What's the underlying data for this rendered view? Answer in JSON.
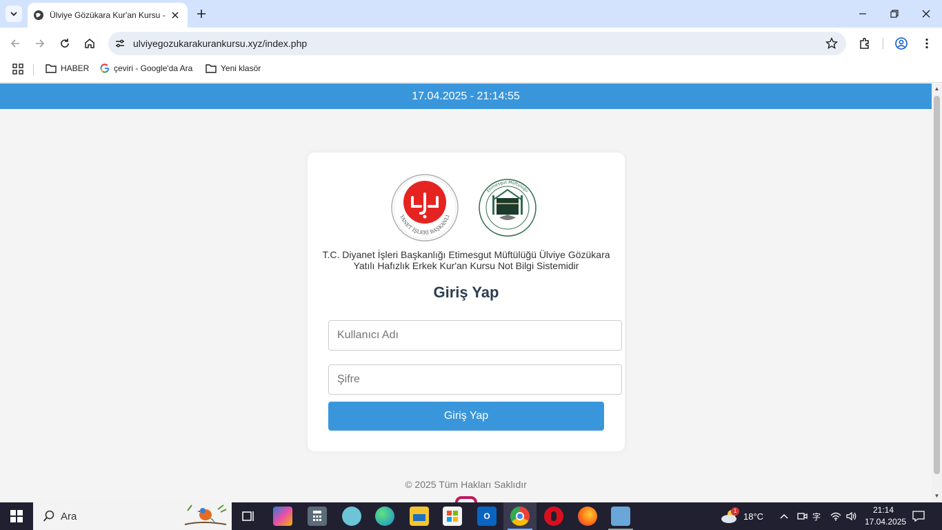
{
  "browser": {
    "tab_title": "Ülviye Gözükara Kur'an Kursu -",
    "url": "ulviyegozukarakurankursu.xyz/index.php",
    "bookmarks": [
      {
        "label": "HABER",
        "icon": "folder-icon"
      },
      {
        "label": "çeviri - Google'da Ara",
        "icon": "google-icon"
      },
      {
        "label": "Yeni klasör",
        "icon": "folder-icon"
      }
    ]
  },
  "page": {
    "datetime": "17.04.2025 - 21:14:55",
    "logos": {
      "diyanet_text": "DİYANET İŞLERİ BAŞKANLIĞI",
      "diyanet_mark": "دٮ",
      "mufti_seal": "Etimesgut Müftülüğü"
    },
    "organization": "T.C. Diyanet İşleri Başkanlığı Etimesgut Müftülüğü Ülviye Gözükara Yatılı Hafızlık Erkek Kur'an Kursu Not Bilgi Sistemidir",
    "heading": "Giriş Yap",
    "username_placeholder": "Kullanıcı Adı",
    "password_placeholder": "Şifre",
    "submit_label": "Giriş Yap",
    "footer": "© 2025 Tüm Hakları Saklıdır"
  },
  "taskbar": {
    "search_placeholder": "Ara",
    "weather_temp": "18°C",
    "weather_badge": "1",
    "time": "21:14",
    "date": "17.04.2025",
    "ime": "字"
  },
  "colors": {
    "accent": "#3a96db",
    "heading": "#2c3e50",
    "tabstrip": "#d3e3fd"
  }
}
